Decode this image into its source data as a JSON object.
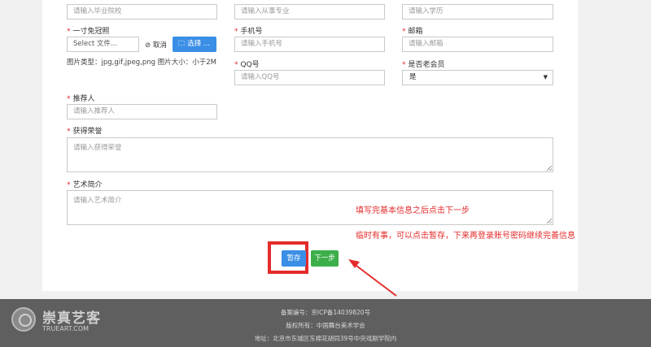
{
  "form": {
    "school": {
      "placeholder": "请输入毕业院校"
    },
    "major": {
      "placeholder": "请输入从事专业"
    },
    "education": {
      "placeholder": "请输入学历"
    },
    "photo": {
      "label": "一寸免冠照",
      "file_text": "Select 文件...",
      "cancel_label": "取消",
      "choose_label": "选择 ...",
      "hint": "图片类型：jpg,gif,jpeg,png   图片大小：小于2M"
    },
    "phone": {
      "label": "手机号",
      "placeholder": "请输入手机号"
    },
    "email": {
      "label": "邮箱",
      "placeholder": "请输入邮箱"
    },
    "qq": {
      "label": "QQ号",
      "placeholder": "请输入QQ号"
    },
    "senior_member": {
      "label": "是否老会员",
      "value": "是"
    },
    "referrer": {
      "label": "推荐人",
      "placeholder": "请输入推荐人"
    },
    "honors": {
      "label": "获得荣誉",
      "placeholder": "请输入获得荣誉"
    },
    "art_intro": {
      "label": "艺术简介",
      "placeholder": "请输入艺术简介"
    },
    "required_mark": "*"
  },
  "actions": {
    "save_label": "暂存",
    "next_label": "下一步"
  },
  "annotations": {
    "note1": "填写完基本信息之后点击下一步",
    "note2": "临时有事，可以点击暂存，下来再登录账号密码继续完善信息",
    "color": "#e42b2b"
  },
  "footer": {
    "record": "备案编号：京ICP备14039820号",
    "copyright": "版权所有：中国舞台美术学会",
    "address": "地址：北京市东城区东棉花胡同39号中央戏剧学院内"
  },
  "watermark": {
    "cn": "崇真艺客",
    "en": "TRUEART.COM"
  },
  "colors": {
    "primary": "#3a8ee6",
    "success": "#3daf4a",
    "required": "#e02a2a"
  }
}
